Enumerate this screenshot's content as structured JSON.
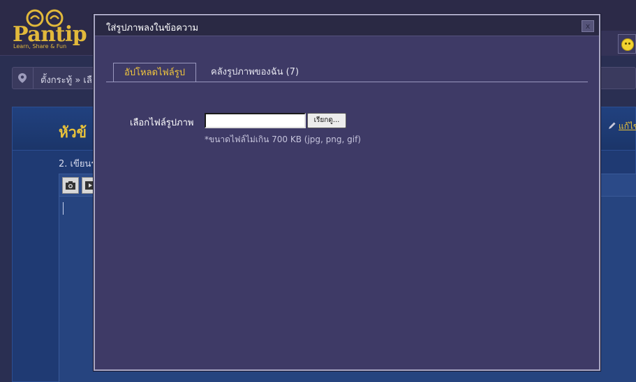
{
  "brand": {
    "name": "Pantip",
    "tagline": "Learn, Share & Fun",
    "color": "#e2b93b"
  },
  "header": {
    "nav_partial": "ี้"
  },
  "breadcrumb": {
    "text": "ตั้งกระทู้ » เลื"
  },
  "page": {
    "topic_title": "หัวข้",
    "edit_link": "แก้ไข",
    "step_label": "2. เขียนร"
  },
  "dialog": {
    "title": "ใส่รูปภาพลงในข้อความ",
    "close_label": "x",
    "tabs": [
      {
        "label": "อัปโหลดไฟล์รูป",
        "active": true
      },
      {
        "label": "คลังรูปภาพของฉัน (7)",
        "active": false
      }
    ],
    "file_label": "เลือกไฟล์รูปภาพ",
    "file_value": "",
    "browse_label": "เรียกดู...",
    "hint": "*ขนาดไฟล์ไม่เกิน 700 KB (jpg, png, gif)"
  },
  "colors": {
    "accent": "#f2c73d",
    "dialog_bg": "#3e3a66",
    "panel_bg": "#1f3a73"
  }
}
